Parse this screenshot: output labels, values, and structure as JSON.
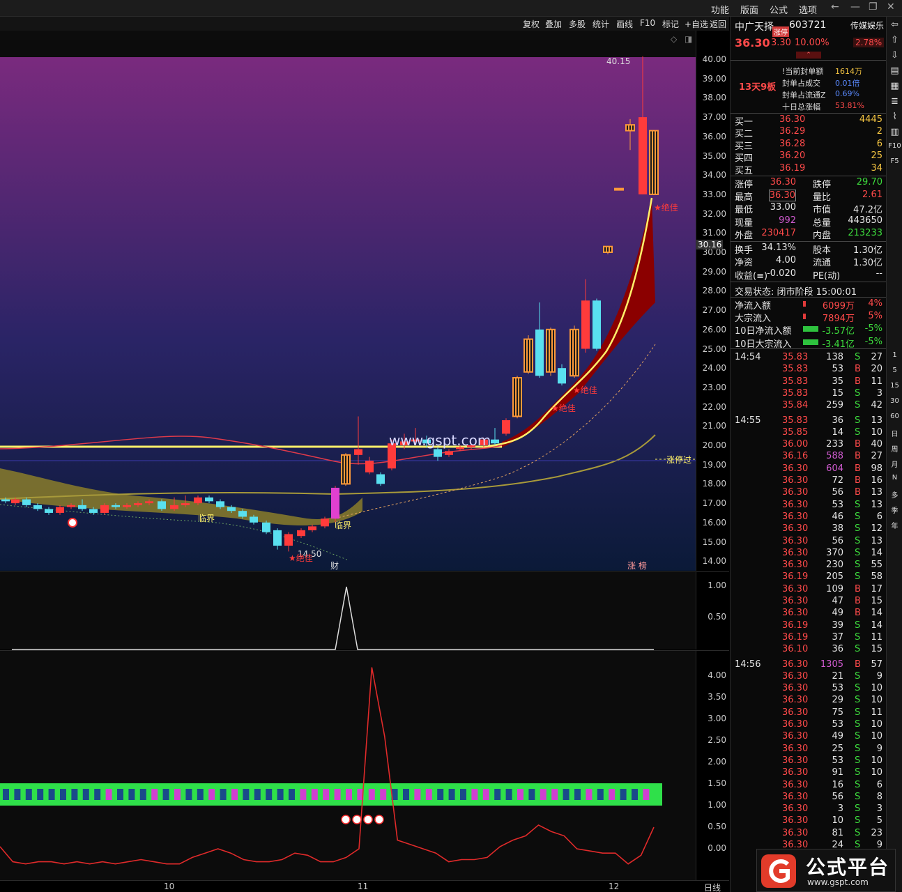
{
  "menubar": {
    "items": [
      "功能",
      "版面",
      "公式",
      "选项"
    ]
  },
  "toolbar": {
    "items": [
      "复权",
      "叠加",
      "多股",
      "统计",
      "画线",
      "F10",
      "标记",
      "+自选",
      "返回"
    ]
  },
  "stock": {
    "name": "中广天择",
    "badge": "涨停",
    "code": "603721",
    "sector": "传媒娱乐",
    "sector_pct": "2.78%",
    "price": "36.30",
    "change": "3.30",
    "pct": "10.00%"
  },
  "seal": {
    "board": "13天9板",
    "rows": [
      {
        "label": "!当前封单额",
        "value": "1614万",
        "cls": "yellow"
      },
      {
        "label": "封单占成交",
        "value": "0.01倍",
        "cls": "blue"
      },
      {
        "label": "封单占流通Z",
        "value": "0.69%",
        "cls": "blue"
      },
      {
        "label": "十日总涨幅",
        "value": "53.81%",
        "cls": "red"
      }
    ]
  },
  "bids": [
    {
      "label": "买一",
      "price": "36.30",
      "vol": "4445"
    },
    {
      "label": "买二",
      "price": "36.29",
      "vol": "2"
    },
    {
      "label": "买三",
      "price": "36.28",
      "vol": "6"
    },
    {
      "label": "买四",
      "price": "36.20",
      "vol": "25"
    },
    {
      "label": "买五",
      "price": "36.19",
      "vol": "34"
    }
  ],
  "quote": [
    {
      "l1": "涨停",
      "v1": "36.30",
      "c1": "red",
      "l2": "跌停",
      "v2": "29.70",
      "c2": "green"
    },
    {
      "l1": "最高",
      "v1": "36.30",
      "c1": "red",
      "l2": "量比",
      "v2": "2.61",
      "c2": "red"
    },
    {
      "l1": "最低",
      "v1": "33.00",
      "c1": "white",
      "l2": "市值",
      "v2": "47.2亿",
      "c2": "white"
    },
    {
      "l1": "现量",
      "v1": "992",
      "c1": "purple",
      "l2": "总量",
      "v2": "443650",
      "c2": "white"
    },
    {
      "l1": "外盘",
      "v1": "230417",
      "c1": "red",
      "l2": "内盘",
      "v2": "213233",
      "c2": "green"
    }
  ],
  "quote2": [
    {
      "l1": "换手",
      "v1": "34.13%",
      "l2": "股本",
      "v2": "1.30亿"
    },
    {
      "l1": "净资",
      "v1": "4.00",
      "l2": "流通",
      "v2": "1.30亿"
    },
    {
      "l1": "收益(≡)",
      "v1": "-0.020",
      "l2": "PE(动)",
      "v2": "--"
    }
  ],
  "trade_status": "交易状态: 闭市阶段 15:00:01",
  "flows": [
    {
      "label": "净流入额",
      "value": "6099万",
      "pct": "4%",
      "cls": "red"
    },
    {
      "label": "大宗流入",
      "value": "7894万",
      "pct": "5%",
      "cls": "red"
    },
    {
      "label": "10日净流入额",
      "value": "-3.57亿",
      "pct": "-5%",
      "cls": "green"
    },
    {
      "label": "10日大宗流入",
      "value": "-3.41亿",
      "pct": "-5%",
      "cls": "green"
    }
  ],
  "ticks": [
    {
      "time": "14:54",
      "price": "35.83",
      "vol": "138",
      "bs": "S",
      "n": "27"
    },
    {
      "time": "",
      "price": "35.83",
      "vol": "53",
      "bs": "B",
      "n": "20"
    },
    {
      "time": "",
      "price": "35.83",
      "vol": "35",
      "bs": "B",
      "n": "11"
    },
    {
      "time": "",
      "price": "35.83",
      "vol": "15",
      "bs": "S",
      "n": "3"
    },
    {
      "time": "",
      "price": "35.84",
      "vol": "259",
      "bs": "S",
      "n": "42"
    },
    {
      "time": "14:55",
      "price": "35.83",
      "vol": "36",
      "bs": "S",
      "n": "13"
    },
    {
      "time": "",
      "price": "35.85",
      "vol": "14",
      "bs": "S",
      "n": "10"
    },
    {
      "time": "",
      "price": "36.00",
      "vol": "233",
      "bs": "B",
      "n": "40"
    },
    {
      "time": "",
      "price": "36.16",
      "vol": "588",
      "bs": "B",
      "n": "27"
    },
    {
      "time": "",
      "price": "36.30",
      "vol": "604",
      "bs": "B",
      "n": "98"
    },
    {
      "time": "",
      "price": "36.30",
      "vol": "72",
      "bs": "B",
      "n": "16"
    },
    {
      "time": "",
      "price": "36.30",
      "vol": "56",
      "bs": "B",
      "n": "13"
    },
    {
      "time": "",
      "price": "36.30",
      "vol": "53",
      "bs": "S",
      "n": "13"
    },
    {
      "time": "",
      "price": "36.30",
      "vol": "46",
      "bs": "S",
      "n": "6"
    },
    {
      "time": "",
      "price": "36.30",
      "vol": "38",
      "bs": "S",
      "n": "12"
    },
    {
      "time": "",
      "price": "36.30",
      "vol": "56",
      "bs": "S",
      "n": "13"
    },
    {
      "time": "",
      "price": "36.30",
      "vol": "370",
      "bs": "S",
      "n": "14"
    },
    {
      "time": "",
      "price": "36.30",
      "vol": "230",
      "bs": "S",
      "n": "55"
    },
    {
      "time": "",
      "price": "36.19",
      "vol": "205",
      "bs": "S",
      "n": "58"
    },
    {
      "time": "",
      "price": "36.30",
      "vol": "109",
      "bs": "B",
      "n": "17"
    },
    {
      "time": "",
      "price": "36.30",
      "vol": "47",
      "bs": "B",
      "n": "15"
    },
    {
      "time": "",
      "price": "36.30",
      "vol": "49",
      "bs": "B",
      "n": "14"
    },
    {
      "time": "",
      "price": "36.19",
      "vol": "39",
      "bs": "S",
      "n": "14"
    },
    {
      "time": "",
      "price": "36.19",
      "vol": "37",
      "bs": "S",
      "n": "11"
    },
    {
      "time": "",
      "price": "36.10",
      "vol": "36",
      "bs": "S",
      "n": "15"
    },
    {
      "time": "14:56",
      "price": "36.30",
      "vol": "1305",
      "bs": "B",
      "n": "57"
    },
    {
      "time": "",
      "price": "36.30",
      "vol": "21",
      "bs": "S",
      "n": "9"
    },
    {
      "time": "",
      "price": "36.30",
      "vol": "53",
      "bs": "S",
      "n": "10"
    },
    {
      "time": "",
      "price": "36.30",
      "vol": "29",
      "bs": "S",
      "n": "10"
    },
    {
      "time": "",
      "price": "36.30",
      "vol": "75",
      "bs": "S",
      "n": "11"
    },
    {
      "time": "",
      "price": "36.30",
      "vol": "53",
      "bs": "S",
      "n": "10"
    },
    {
      "time": "",
      "price": "36.30",
      "vol": "49",
      "bs": "S",
      "n": "10"
    },
    {
      "time": "",
      "price": "36.30",
      "vol": "25",
      "bs": "S",
      "n": "9"
    },
    {
      "time": "",
      "price": "36.30",
      "vol": "53",
      "bs": "S",
      "n": "10"
    },
    {
      "time": "",
      "price": "36.30",
      "vol": "91",
      "bs": "S",
      "n": "10"
    },
    {
      "time": "",
      "price": "36.30",
      "vol": "16",
      "bs": "S",
      "n": "6"
    },
    {
      "time": "",
      "price": "36.30",
      "vol": "56",
      "bs": "S",
      "n": "8"
    },
    {
      "time": "",
      "price": "36.30",
      "vol": "3",
      "bs": "S",
      "n": "3"
    },
    {
      "time": "",
      "price": "36.30",
      "vol": "10",
      "bs": "S",
      "n": "5"
    },
    {
      "time": "",
      "price": "36.30",
      "vol": "81",
      "bs": "S",
      "n": "23"
    },
    {
      "time": "",
      "price": "36.30",
      "vol": "24",
      "bs": "S",
      "n": "9"
    }
  ],
  "price_axis": [
    "40.00",
    "39.00",
    "38.00",
    "37.00",
    "36.00",
    "35.00",
    "34.00",
    "33.00",
    "32.00",
    "31.00",
    "30.00",
    "29.00",
    "28.00",
    "27.00",
    "26.00",
    "25.00",
    "24.00",
    "23.00",
    "22.00",
    "21.00",
    "20.00",
    "19.00",
    "18.00",
    "17.00",
    "16.00",
    "15.00",
    "14.00"
  ],
  "price_marker": "30.16",
  "ind1_axis": [
    "1.00",
    "0.50"
  ],
  "ind2_axis": [
    "4.00",
    "3.50",
    "3.00",
    "2.50",
    "2.00",
    "1.50",
    "1.00",
    "0.50",
    "0.00"
  ],
  "dates": [
    "10",
    "11",
    "12"
  ],
  "period": "日线",
  "annotations": {
    "high": "40.15",
    "low": "14.50",
    "lijie1": "临界",
    "lijie2": "临界",
    "jiajia1": "★绝佳",
    "jiajia2": "★绝佳",
    "jiajia3": "★绝佳",
    "jiajia4": "★绝佳",
    "zhangting_guo": "涨停过",
    "cai": "财",
    "zhangbang": "涨 榜",
    "site": "www.gspt.com"
  },
  "right_tools": [
    "F10",
    "F5",
    "1",
    "5",
    "15",
    "30",
    "60",
    "日",
    "周",
    "月",
    "N",
    "多",
    "季",
    "年"
  ],
  "badge": {
    "name": "公式平台",
    "url": "www.gspt.com"
  },
  "colors": {
    "up": "#ff3b3b",
    "down": "#59e0f0",
    "limit": "#ff9a3a",
    "ma_yellow": "#fff06a",
    "band": "#8b0000"
  },
  "chart_data": [
    {
      "type": "line",
      "title": "",
      "series": [
        {
          "values": [
            0,
            0,
            0,
            0,
            0,
            0,
            0,
            0,
            0,
            0,
            0,
            0,
            0,
            0,
            0,
            0,
            0,
            0,
            0,
            0,
            0,
            0,
            0,
            0,
            0,
            0,
            0,
            0,
            0,
            0,
            1,
            0,
            0,
            0,
            0,
            0,
            0,
            0,
            0,
            0,
            0,
            0,
            0,
            0,
            0,
            0,
            0,
            0,
            0,
            0,
            0,
            0,
            0,
            0,
            0,
            0,
            0,
            0,
            0,
            0
          ]
        }
      ],
      "ylim": [
        0,
        1.2
      ]
    },
    {
      "type": "line",
      "title": "",
      "series": [
        {
          "values": [
            0.05,
            -0.3,
            -0.35,
            -0.3,
            -0.3,
            -0.35,
            -0.3,
            -0.35,
            -0.3,
            -0.35,
            -0.3,
            -0.25,
            -0.3,
            -0.35,
            -0.35,
            -0.2,
            -0.1,
            0,
            -0.1,
            -0.25,
            -0.3,
            -0.3,
            -0.25,
            -0.1,
            -0.15,
            -0.3,
            -0.3,
            -0.2,
            0,
            4.2,
            2.6,
            0.2,
            0.1,
            0.0,
            -0.1,
            -0.3,
            -0.25,
            -0.25,
            -0.2,
            0.05,
            0.2,
            0.3,
            0.55,
            0.4,
            0.3,
            0.0,
            -0.05,
            -0.1,
            -0.1,
            -0.35,
            -0.15,
            0.5
          ]
        }
      ],
      "ylim": [
        -0.5,
        4.5
      ]
    }
  ]
}
